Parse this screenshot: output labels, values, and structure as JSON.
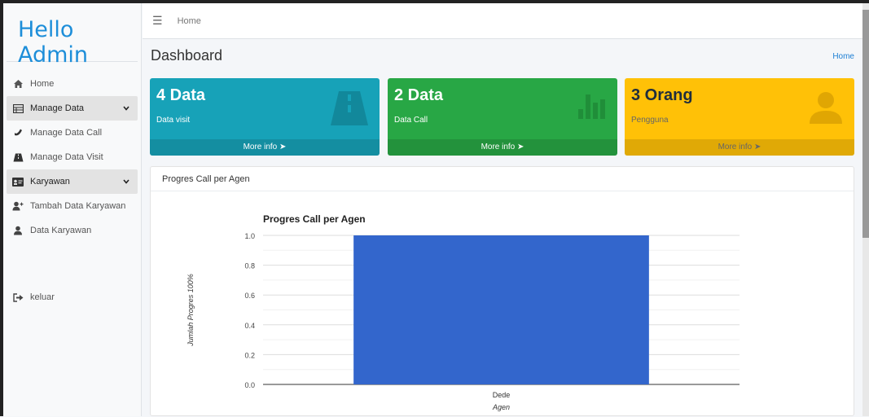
{
  "sidebar": {
    "brand": "Hello Admin",
    "items": [
      {
        "label": "Home",
        "icon": "home-icon"
      },
      {
        "label": "Manage Data",
        "icon": "table-icon"
      },
      {
        "label": "Manage Data Call",
        "icon": "phone-icon"
      },
      {
        "label": "Manage Data Visit",
        "icon": "road-icon"
      },
      {
        "label": "Karyawan",
        "icon": "id-card-icon"
      },
      {
        "label": "Tambah Data Karyawan",
        "icon": "user-plus-icon"
      },
      {
        "label": "Data Karyawan",
        "icon": "user-icon"
      },
      {
        "label": "keluar",
        "icon": "sign-out-icon"
      }
    ]
  },
  "topbar": {
    "menu_icon": "hamburger-icon",
    "home_link": "Home"
  },
  "header": {
    "title": "Dashboard",
    "breadcrumb": "Home"
  },
  "boxes": [
    {
      "value": "4 Data",
      "label": "Data visit",
      "more": "More info",
      "color": "#17a2b8",
      "icon": "road-icon"
    },
    {
      "value": "2 Data",
      "label": "Data Call",
      "more": "More info",
      "color": "#28a745",
      "icon": "bar-chart-icon"
    },
    {
      "value": "3 Orang",
      "label": "Pengguna",
      "more": "More info",
      "color": "#ffc107",
      "icon": "user-icon"
    }
  ],
  "card": {
    "title": "Progres Call per Agen"
  },
  "chart_data": {
    "type": "bar",
    "title": "Progres Call per Agen",
    "categories": [
      "Dede"
    ],
    "values": [
      1.0
    ],
    "xlabel": "Agen",
    "ylabel": "Jumlah Progres 100%",
    "ylim": [
      0,
      1.0
    ],
    "yticks": [
      "0.0",
      "0.2",
      "0.4",
      "0.6",
      "0.8",
      "1.0"
    ],
    "bar_color": "#3366cc",
    "grid": true
  }
}
